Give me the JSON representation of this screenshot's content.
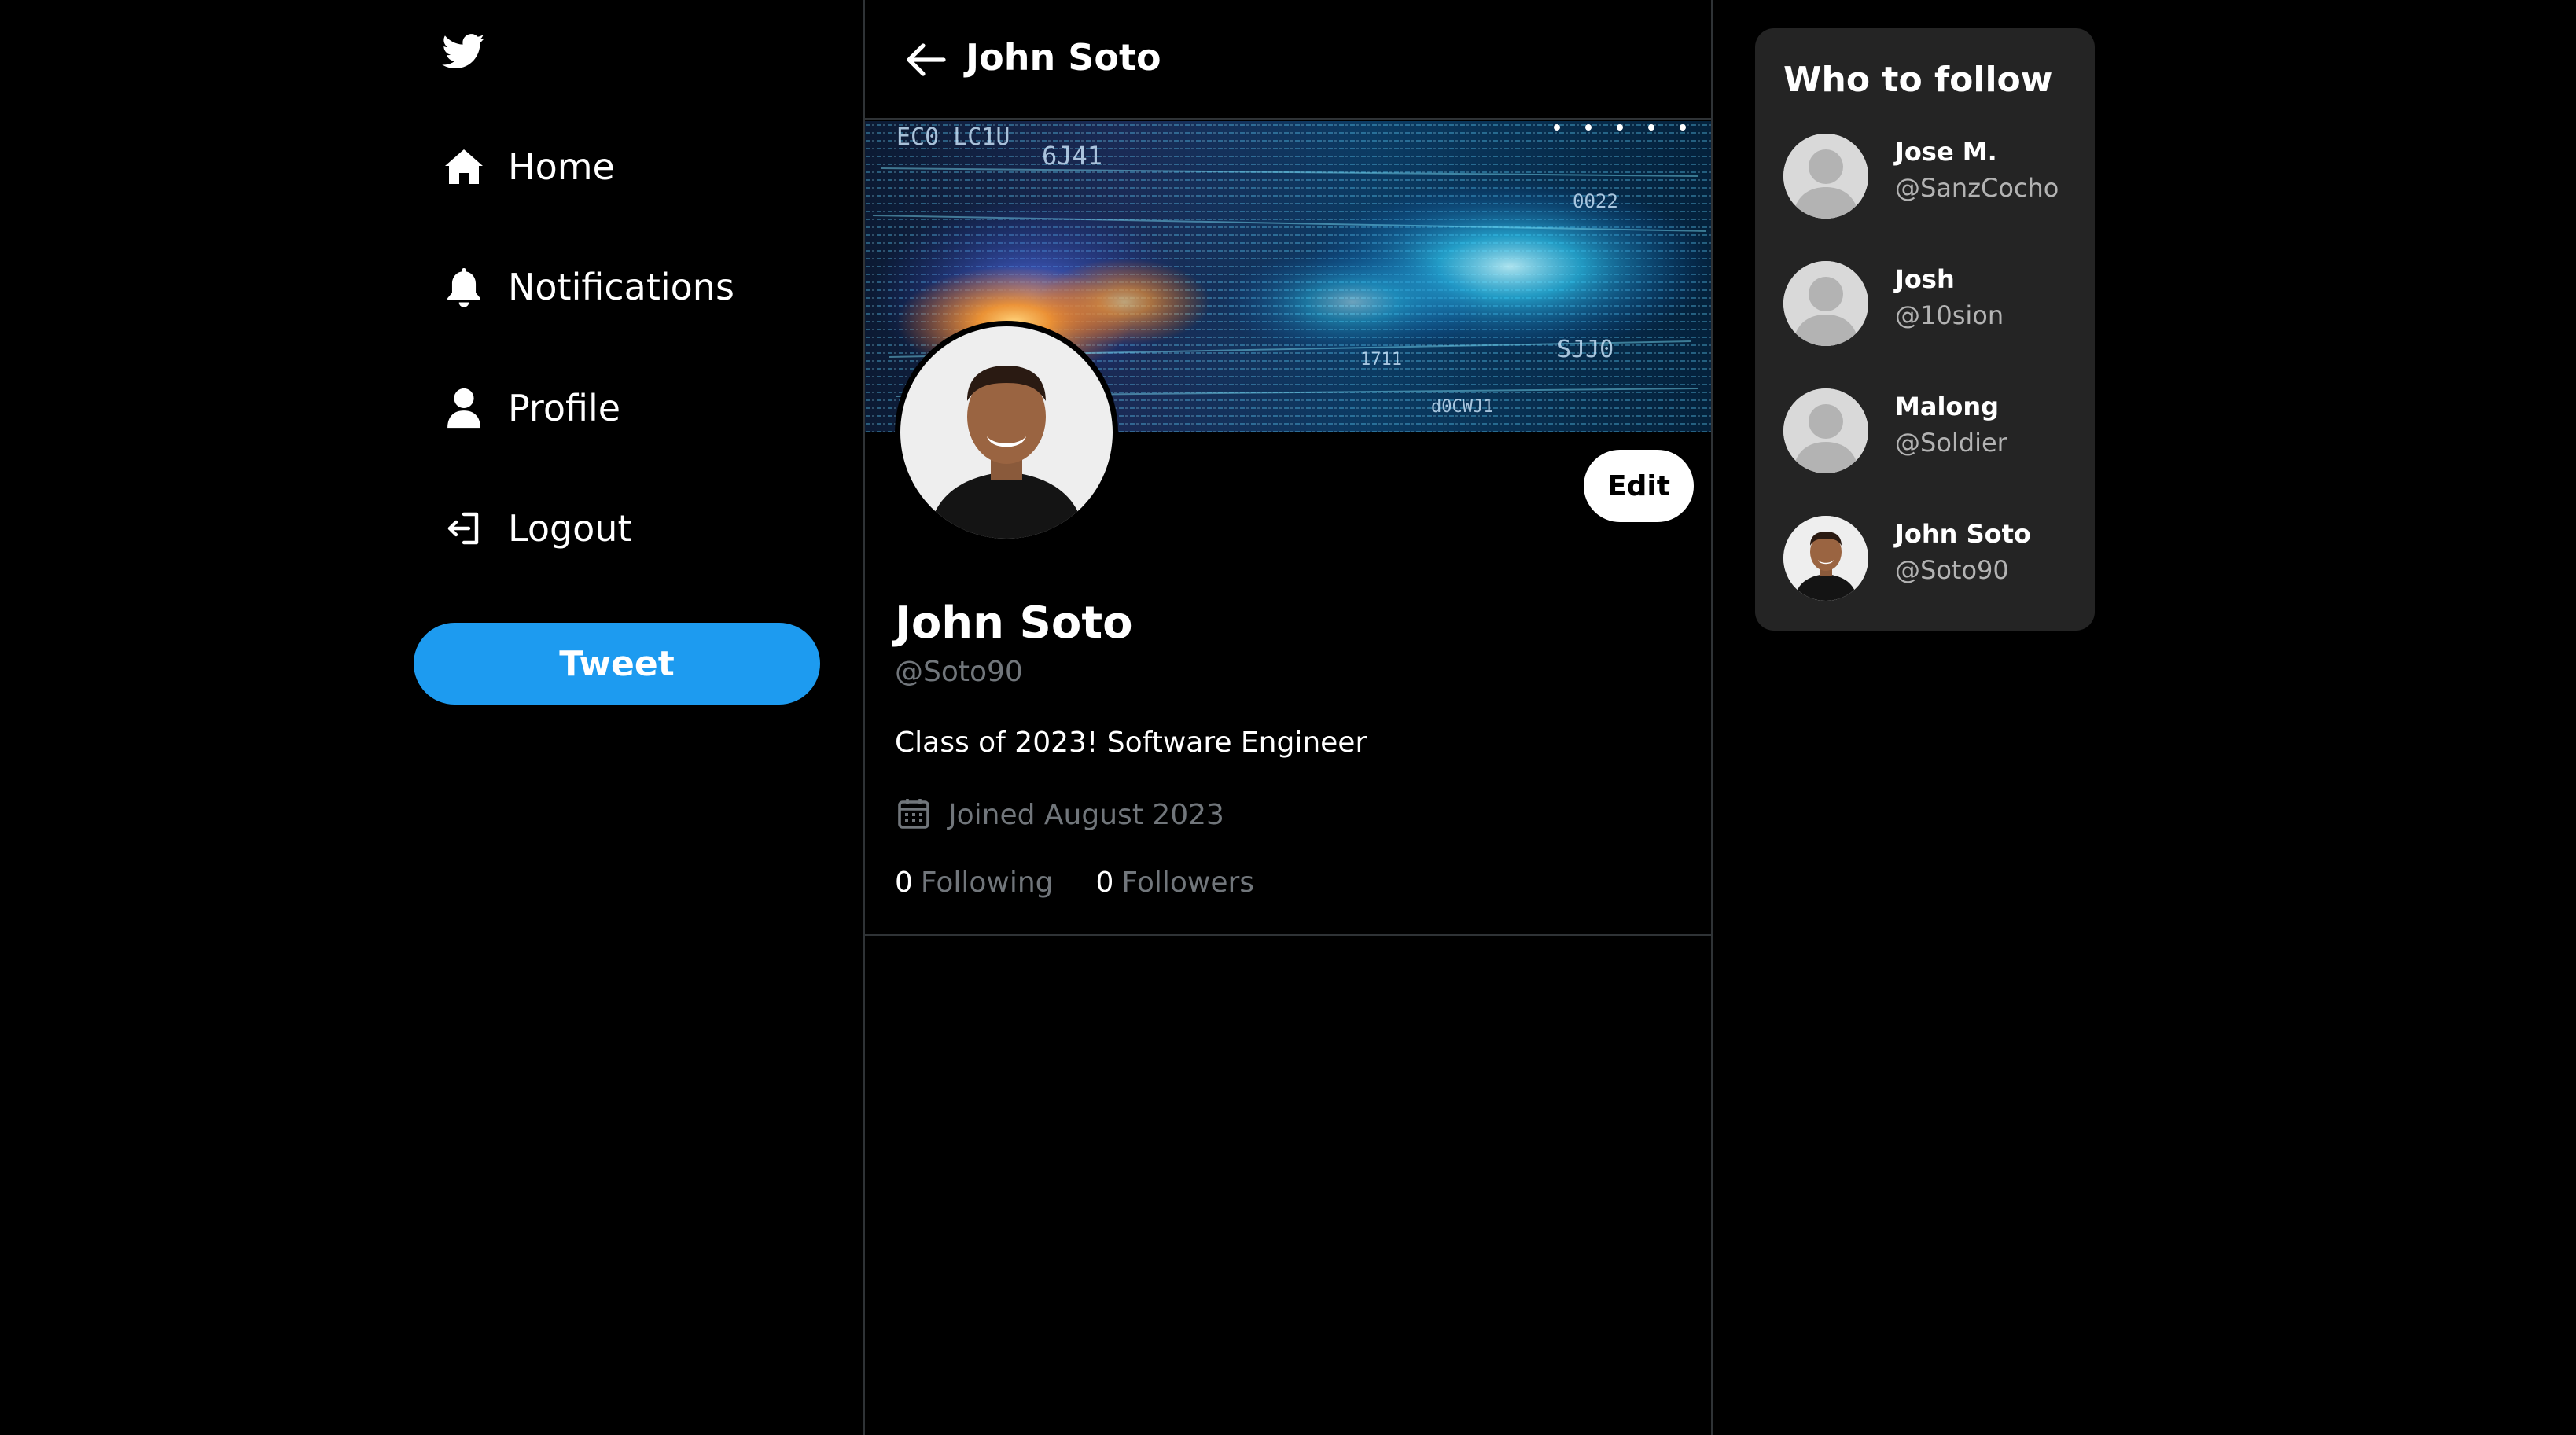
{
  "sidebar": {
    "logo": "twitter-bird-icon",
    "items": [
      {
        "label": "Home",
        "icon": "home-icon"
      },
      {
        "label": "Notifications",
        "icon": "bell-icon"
      },
      {
        "label": "Profile",
        "icon": "user-icon"
      },
      {
        "label": "Logout",
        "icon": "logout-icon"
      }
    ],
    "tweet_label": "Tweet"
  },
  "header": {
    "title": "John Soto",
    "back_icon": "arrow-left-icon"
  },
  "profile": {
    "name": "John Soto",
    "handle": "@Soto90",
    "bio": "Class of 2023! Software Engineer",
    "joined": "Joined August 2023",
    "joined_icon": "calendar-icon",
    "edit_label": "Edit",
    "following_count": "0",
    "following_label": "Following",
    "followers_count": "0",
    "followers_label": "Followers",
    "banner_text": [
      "EC0 LC1U",
      "6J41",
      "SJJ0",
      "0022",
      "1711",
      "d0CWJ1"
    ]
  },
  "who_to_follow": {
    "title": "Who to follow",
    "users": [
      {
        "name": "Jose M.",
        "handle": "@SanzCocho",
        "avatar": "default"
      },
      {
        "name": "Josh",
        "handle": "@10sion",
        "avatar": "default"
      },
      {
        "name": "Malong",
        "handle": "@Soldier",
        "avatar": "default"
      },
      {
        "name": "John Soto",
        "handle": "@Soto90",
        "avatar": "photo"
      }
    ]
  },
  "colors": {
    "background": "#000000",
    "accent": "#1d9bf0",
    "panel": "#242424",
    "muted": "#71767b",
    "border": "#2f3336"
  }
}
